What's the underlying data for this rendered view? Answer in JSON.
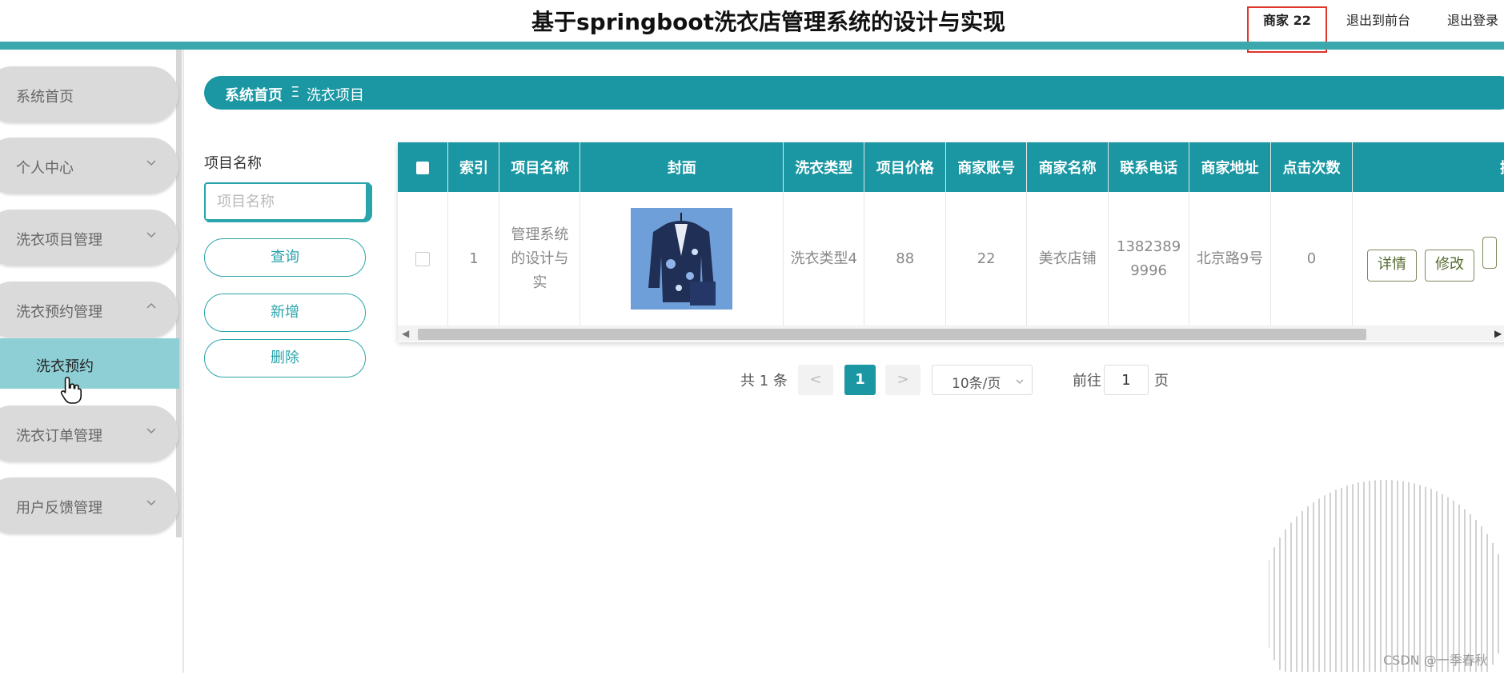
{
  "header": {
    "title": "基于springboot洗衣店管理系统的设计与实现",
    "user": "商家 22",
    "back_to_front": "退出到前台",
    "logout": "退出登录"
  },
  "sidebar": {
    "items": [
      {
        "label": "系统首页"
      },
      {
        "label": "个人中心"
      },
      {
        "label": "洗衣项目管理"
      },
      {
        "label": "洗衣预约管理"
      },
      {
        "label": "洗衣订单管理"
      },
      {
        "label": "用户反馈管理"
      }
    ],
    "active_sub": "洗衣预约"
  },
  "breadcrumb": {
    "home": "系统首页",
    "separator": "Ξ",
    "current": "洗衣项目"
  },
  "search": {
    "label": "项目名称",
    "placeholder": "项目名称",
    "query_button": "查询",
    "add_button": "新增",
    "delete_button": "删除"
  },
  "table": {
    "headers": [
      "索引",
      "项目名称",
      "封面",
      "洗衣类型",
      "项目价格",
      "商家账号",
      "商家名称",
      "联系电话",
      "商家地址",
      "点击次数",
      "操"
    ],
    "rows": [
      {
        "index": "1",
        "name": "管理系统的设计与实",
        "type": "洗衣类型4",
        "price": "88",
        "account": "22",
        "shop_name": "美衣店铺",
        "phone": "13823899996",
        "address": "北京路9号",
        "clicks": "0",
        "actions": [
          "详情",
          "修改"
        ]
      }
    ]
  },
  "pagination": {
    "total": "共 1 条",
    "prev": "<",
    "current": "1",
    "next": ">",
    "page_size": "10条/页",
    "goto_label": "前往",
    "goto_value": "1",
    "goto_unit": "页"
  },
  "watermark": "CSDN @一季春秋",
  "colors": {
    "accent": "#1a97a3",
    "header_bar": "#3aa8ad",
    "sidebar_item": "#dadada",
    "active_sub": "#8ecfd5",
    "highlight_box": "#e0352b"
  }
}
